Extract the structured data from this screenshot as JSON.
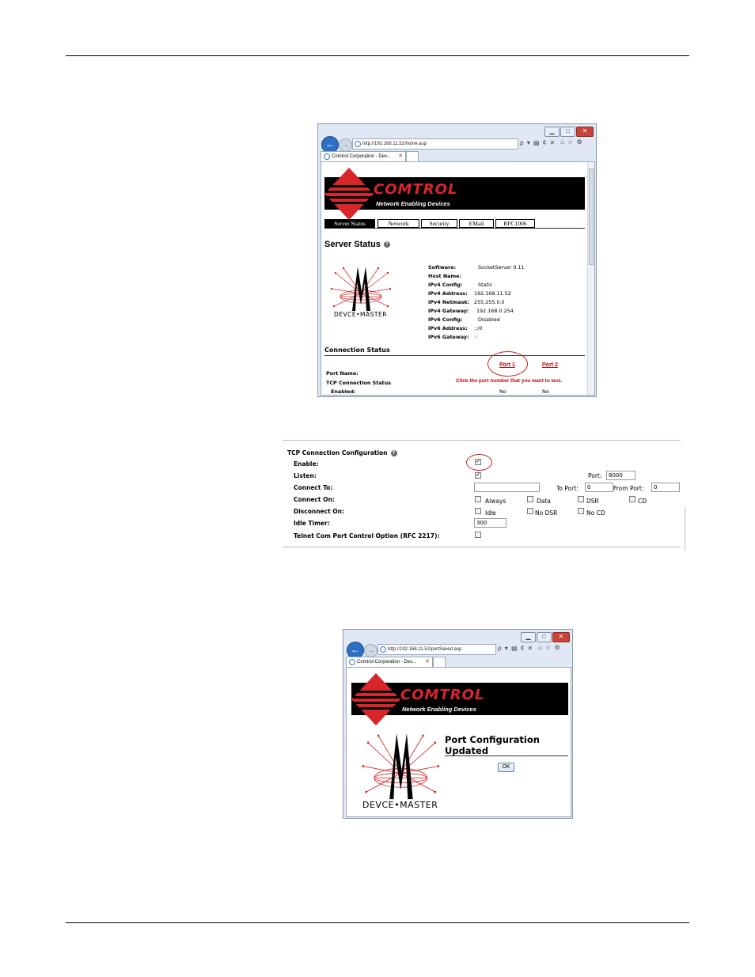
{
  "screenshot1": {
    "address": "http://192.168.11.52/home.asp",
    "tab_title": "Comtrol Corporation - Dev...",
    "address_tools": "ρ ▾ ▤ ¢ ✕",
    "brand": "COMTROL",
    "tagline": "Network Enabling Devices",
    "nav_tabs": [
      "Server Status",
      "Network",
      "Security",
      "EMail",
      "RFC1006"
    ],
    "server_status_title": "Server Status",
    "fields": [
      {
        "label": "Software:",
        "value": "SocketServer 9.11"
      },
      {
        "label": "Host Name:",
        "value": ""
      },
      {
        "label": "IPv4 Config:",
        "value": "Static"
      },
      {
        "label": "IPv4 Address:",
        "value": "192.168.11.52"
      },
      {
        "label": "IPv4 Netmask:",
        "value": "255.255.0.0"
      },
      {
        "label": "IPv4 Gateway:",
        "value": "192.168.0.254"
      },
      {
        "label": "IPv6 Config:",
        "value": "Disabled"
      },
      {
        "label": "IPv6 Address:",
        "value": "::/0"
      },
      {
        "label": "IPv6 Gateway:",
        "value": "::"
      }
    ],
    "connection_status": "Connection Status",
    "port1": "Port 1",
    "port2": "Port 2",
    "port_name_label": "Port Name:",
    "tcp_status_label": "TCP Connection Status",
    "click_note": "Click the port number that you want to test.",
    "enabled_label": "Enabled:",
    "enabled_port1": "No",
    "enabled_port2": "No"
  },
  "config": {
    "title": "TCP Connection Configuration",
    "enable_label": "Enable:",
    "listen_label": "Listen:",
    "port_label": "Port:",
    "port_value": "8000",
    "connect_to_label": "Connect To:",
    "connect_to_value": "",
    "to_port_label": "To Port:",
    "to_port_value": "0",
    "from_port_label": "From Port:",
    "from_port_value": "0",
    "connect_on_label": "Connect On:",
    "connect_on_options": [
      "Always",
      "Data",
      "DSR",
      "CD"
    ],
    "disconnect_on_label": "Disconnect On:",
    "disconnect_on_options": [
      "Idle",
      "No DSR",
      "No CD"
    ],
    "idle_timer_label": "Idle Timer:",
    "idle_timer_value": "300",
    "telnet_label": "Telnet Com Port Control Option (RFC 2217):"
  },
  "screenshot2": {
    "address": "http://192.168.11.52/portSaved.asp",
    "tab_title": "Comtrol Corporation - Dev...",
    "address_tools": "ρ ▾ ▤ ¢ ✕",
    "brand": "COMTROL",
    "tagline": "Network Enabling Devices",
    "title": "Port Configuration Updated",
    "ok_label": "OK"
  },
  "devicemaster": {
    "left": "DEV",
    "right": "CE•MASTER"
  }
}
